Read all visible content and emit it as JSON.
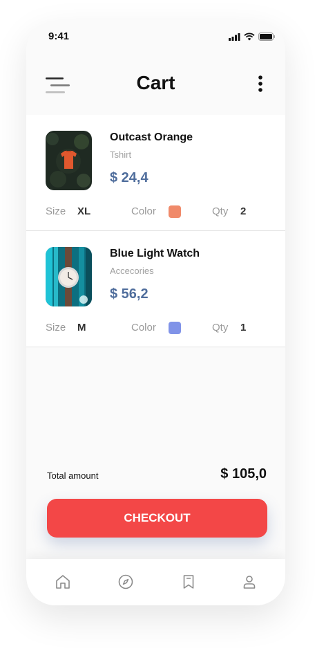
{
  "status_bar": {
    "time": "9:41"
  },
  "header": {
    "title": "Cart",
    "menu_icon": "menu-icon",
    "more_icon": "more-vertical-icon"
  },
  "cart_items": [
    {
      "name": "Outcast Orange",
      "category": "Tshirt",
      "price": "$ 24,4",
      "size_label": "Size",
      "size": "XL",
      "color_label": "Color",
      "color": "#f08a6a",
      "qty_label": "Qty",
      "qty": "2"
    },
    {
      "name": "Blue Light Watch",
      "category": "Accecories",
      "price": "$ 56,2",
      "size_label": "Size",
      "size": "M",
      "color_label": "Color",
      "color": "#8093e8",
      "qty_label": "Qty",
      "qty": "1"
    }
  ],
  "summary": {
    "total_label": "Total amount",
    "total_value": "$ 105,0"
  },
  "checkout": {
    "label": "CHECKOUT"
  },
  "tab_bar": {
    "tabs": [
      {
        "icon": "home-icon"
      },
      {
        "icon": "compass-icon"
      },
      {
        "icon": "bookmark-icon"
      },
      {
        "icon": "user-icon"
      }
    ]
  },
  "colors": {
    "accent": "#f34747",
    "price": "#4f6d9c"
  }
}
